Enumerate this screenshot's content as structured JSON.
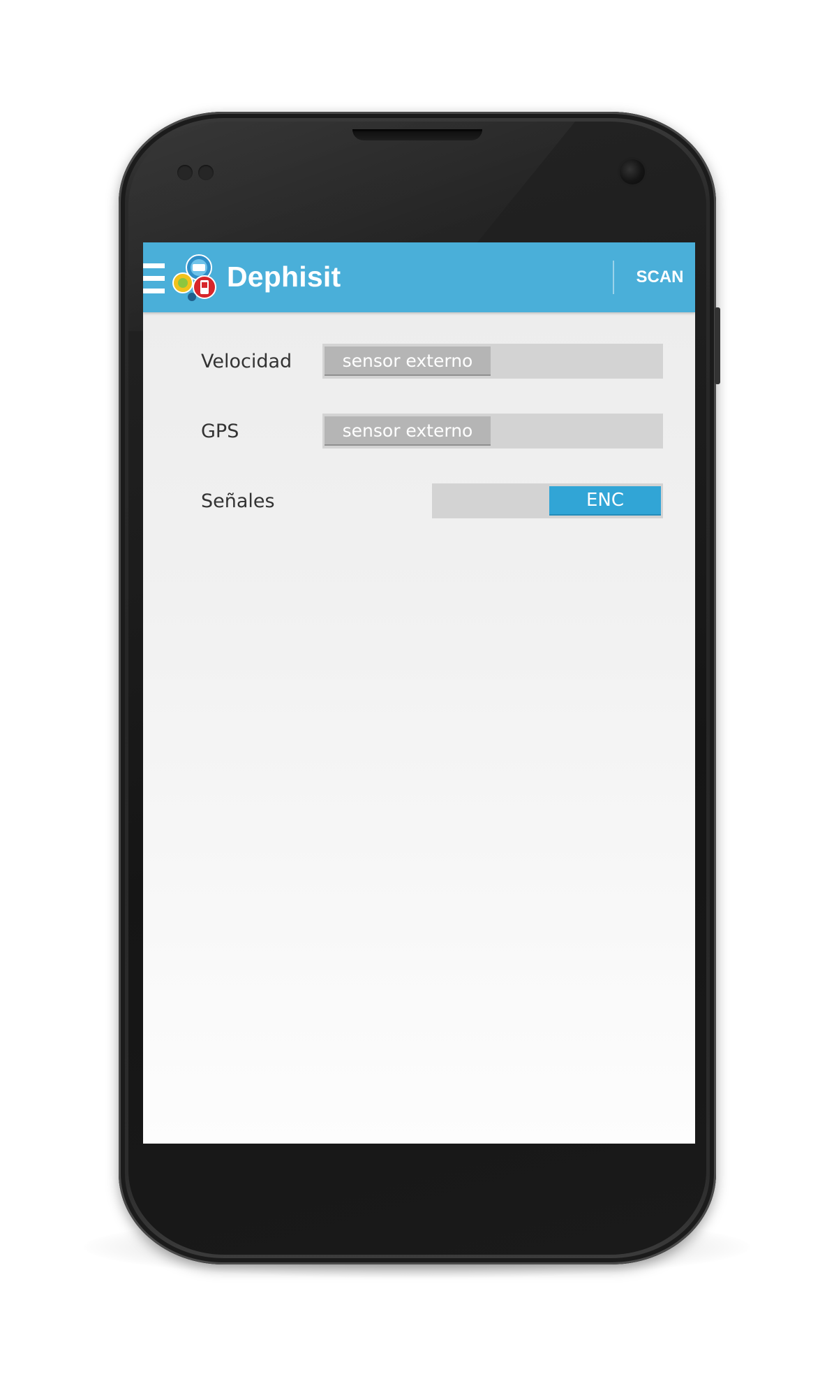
{
  "action_bar": {
    "title": "Dephisit",
    "action_label": "SCAN",
    "background_color": "#4aafd9",
    "menu_icon": "hamburger-menu-icon",
    "logo_icon": "app-logo-icon"
  },
  "settings": {
    "rows": [
      {
        "label": "Velocidad",
        "value": "sensor externo"
      },
      {
        "label": "GPS",
        "value": "sensor externo"
      },
      {
        "label": "Señales",
        "value": "ENC"
      }
    ],
    "toggle_color": "#31a5d6"
  }
}
